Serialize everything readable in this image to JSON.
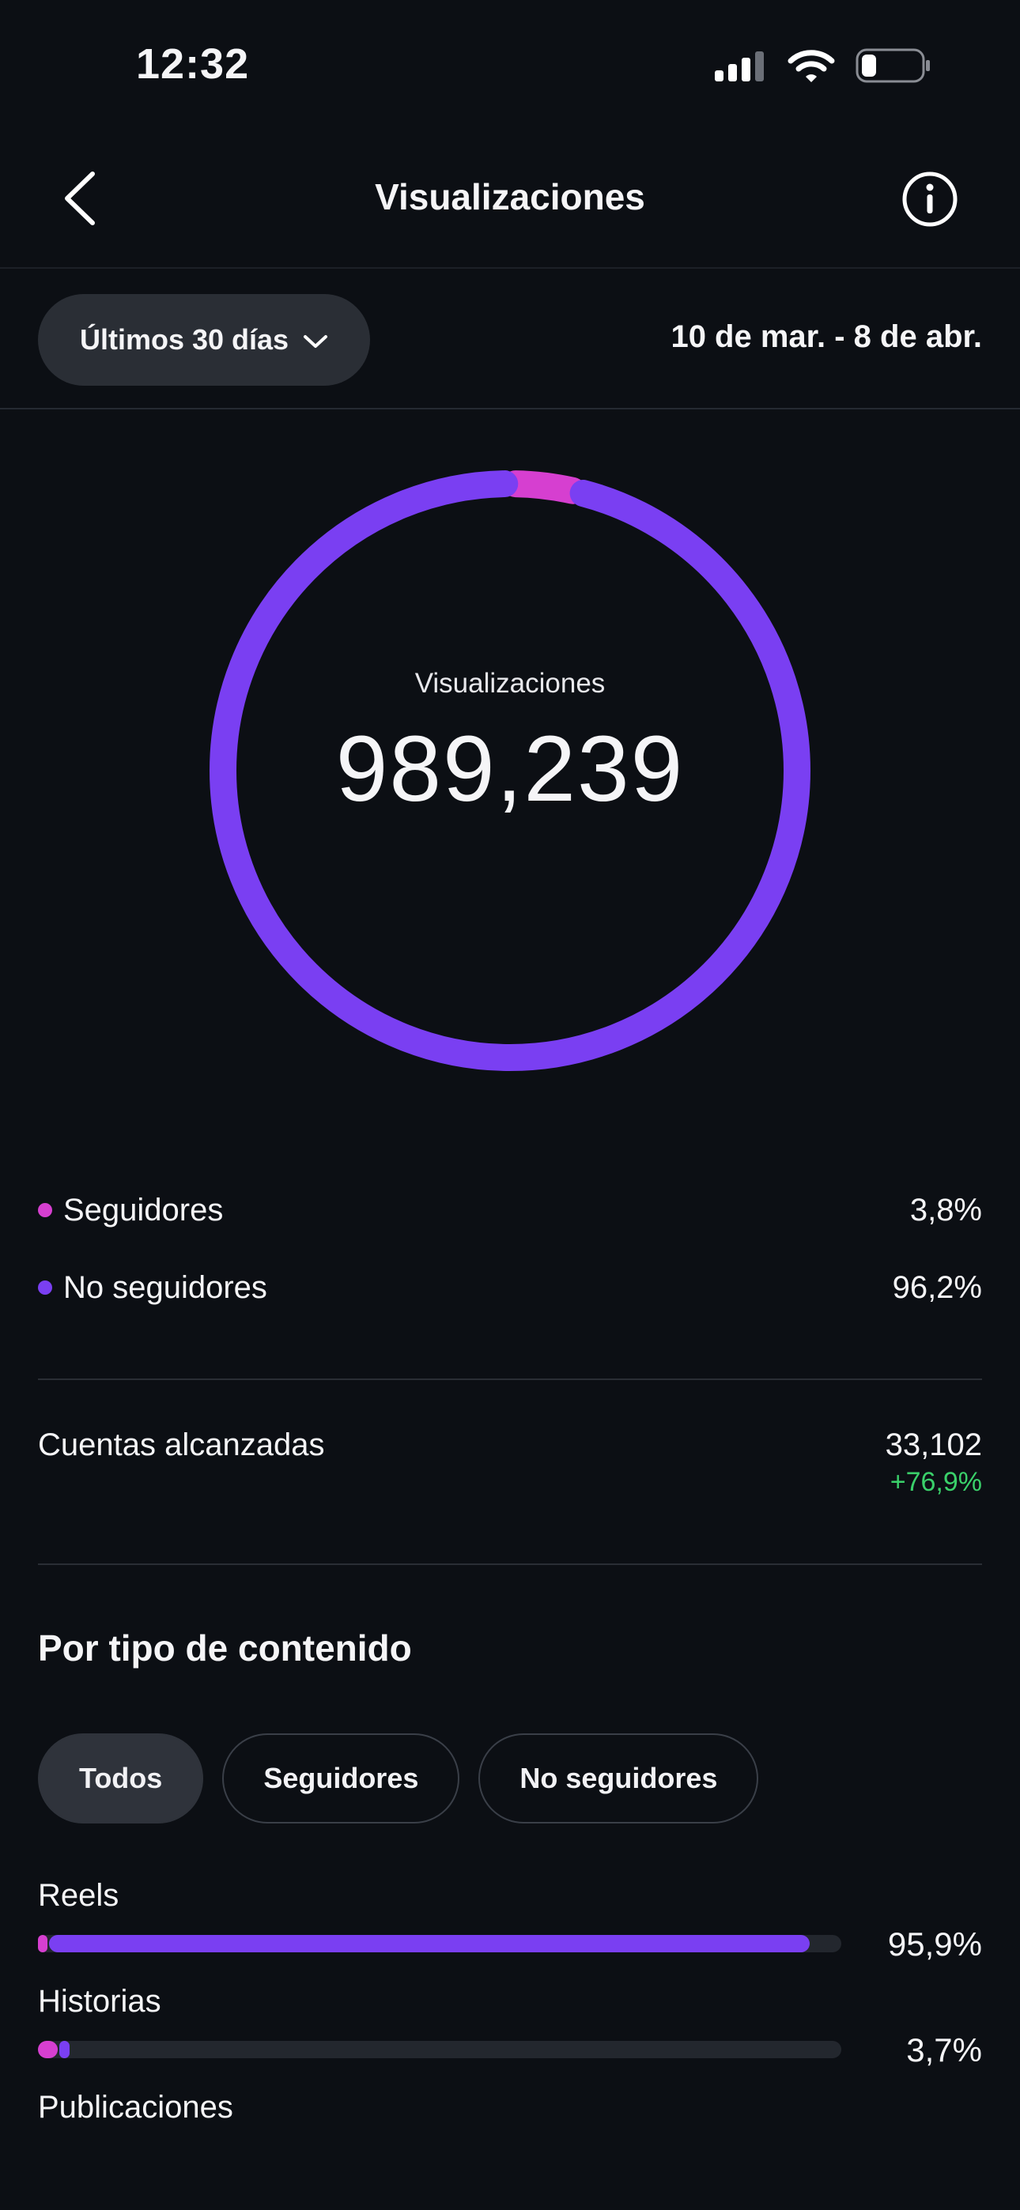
{
  "status_bar": {
    "time": "12:32",
    "icons": [
      "cellular-signal-icon",
      "wifi-icon",
      "battery-icon"
    ]
  },
  "nav": {
    "title": "Visualizaciones",
    "back_icon": "chevron-left-icon",
    "info_icon": "info-icon"
  },
  "filter": {
    "range_label": "Últimos 30 días",
    "date_range": "10 de mar. - 8 de abr."
  },
  "donut": {
    "label": "Visualizaciones",
    "value": "989,239",
    "segments": [
      {
        "name": "Seguidores",
        "percent": 3.8,
        "color": "#d63fd0"
      },
      {
        "name": "No seguidores",
        "percent": 96.2,
        "color": "#7a3ff2"
      }
    ]
  },
  "legend": [
    {
      "label": "Seguidores",
      "value": "3,8%",
      "color": "#d63fd0"
    },
    {
      "label": "No seguidores",
      "value": "96,2%",
      "color": "#7a3ff2"
    }
  ],
  "reach": {
    "label": "Cuentas alcanzadas",
    "value": "33,102",
    "delta": "+76,9%"
  },
  "content_type": {
    "title": "Por tipo de contenido",
    "chips": [
      {
        "label": "Todos",
        "active": true
      },
      {
        "label": "Seguidores",
        "active": false
      },
      {
        "label": "No seguidores",
        "active": false
      }
    ],
    "bars": [
      {
        "label": "Reels",
        "percent_text": "95,9%",
        "followers_fraction": 0.012,
        "nonfollowers_fraction": 0.947
      },
      {
        "label": "Historias",
        "percent_text": "3,7%",
        "followers_fraction": 0.025,
        "nonfollowers_fraction": 0.012
      },
      {
        "label": "Publicaciones",
        "percent_text": "",
        "followers_fraction": 0,
        "nonfollowers_fraction": 0
      }
    ]
  },
  "colors": {
    "followers": "#d63fd0",
    "non_followers": "#7a3ff2",
    "positive": "#3ad06a",
    "background": "#0c0f14"
  }
}
